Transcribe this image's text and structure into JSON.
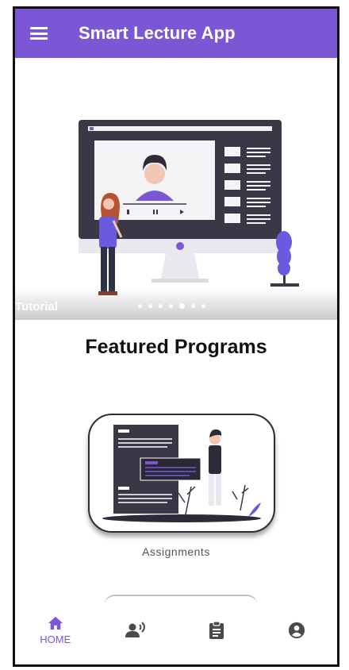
{
  "appbar": {
    "title": "Smart Lecture App",
    "menu_icon": "menu-icon",
    "background": "#7b57d6"
  },
  "carousel": {
    "caption": "Tutorial",
    "slide_count": 7,
    "active_slide": 4
  },
  "featured": {
    "title": "Featured Programs",
    "programs": [
      {
        "label": "Assignments"
      }
    ]
  },
  "bottom_nav": {
    "active": "home",
    "accent": "#7b57d6",
    "inactive_color": "#4a4a4a",
    "items": [
      {
        "id": "home",
        "icon": "home-icon",
        "label": "HOME"
      },
      {
        "id": "lecture",
        "icon": "speaking-person-icon",
        "label": ""
      },
      {
        "id": "assignments",
        "icon": "clipboard-icon",
        "label": ""
      },
      {
        "id": "profile",
        "icon": "account-circle-icon",
        "label": ""
      }
    ]
  }
}
